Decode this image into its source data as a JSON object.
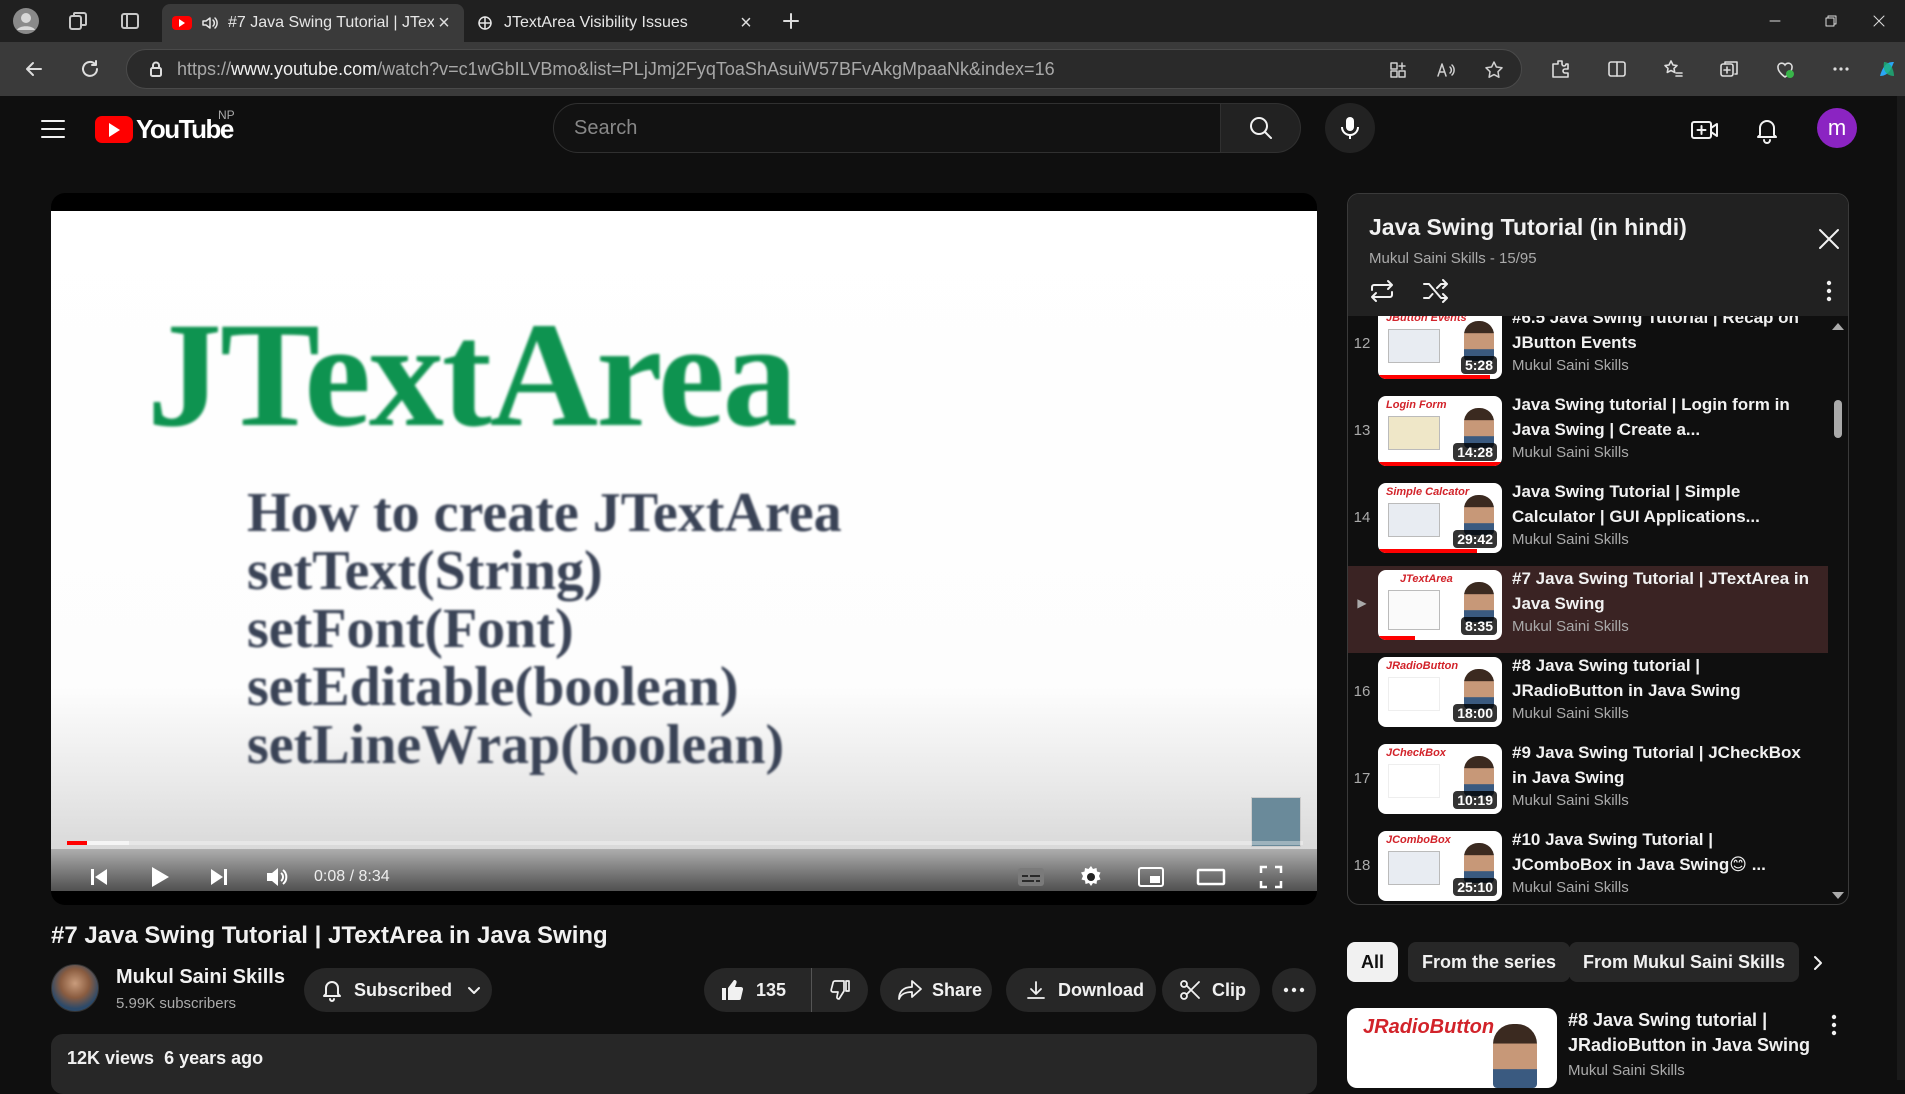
{
  "browser": {
    "tabs": [
      {
        "title": "#7 Java Swing Tutorial | JTextArea in Java Swing",
        "active": true
      },
      {
        "title": "JTextArea Visibility Issues",
        "active": false
      }
    ],
    "url_prefix": "https://",
    "url_host": "www.youtube.com",
    "url_path": "/watch?v=c1wGbILVBmo&list=PLjJmj2FyqToaShAsuiW57BFvAkgMpaaNk&index=16"
  },
  "youtube": {
    "logo_text": "YouTube",
    "country_code": "NP",
    "search_placeholder": "Search",
    "avatar_letter": "m"
  },
  "player": {
    "slide_title": "JTextArea",
    "slide_lines": [
      "How to create JTextArea",
      "setText(String)",
      "setFont(Font)",
      "setEditable(boolean)",
      "setLineWrap(boolean)"
    ],
    "time": "0:08 / 8:34",
    "progress_fraction": 0.016,
    "buffered_fraction": 0.05
  },
  "video": {
    "title": "#7 Java Swing Tutorial | JTextArea in Java Swing",
    "channel": "Mukul Saini Skills",
    "subscribers": "5.99K subscribers",
    "subscribed_label": "Subscribed",
    "likes": "135",
    "share_label": "Share",
    "download_label": "Download",
    "clip_label": "Clip",
    "views": "12K views",
    "age": "6 years ago"
  },
  "playlist": {
    "title": "Java Swing Tutorial (in hindi)",
    "subtitle": "Mukul Saini Skills - 15/95",
    "items": [
      {
        "index": "12",
        "title": "#6.5 Java Swing Tutorial | Recap on JButton Events",
        "channel": "Mukul Saini Skills",
        "duration": "5:28",
        "thumb_label": "JButton Events",
        "watched": 0.9
      },
      {
        "index": "13",
        "title": "Java Swing tutorial | Login form in Java Swing | Create a...",
        "channel": "Mukul Saini Skills",
        "duration": "14:28",
        "thumb_label": "Login Form",
        "watched": 1.0
      },
      {
        "index": "14",
        "title": "Java Swing Tutorial | Simple Calculator | GUI Applications...",
        "channel": "Mukul Saini Skills",
        "duration": "29:42",
        "thumb_label": "Simple Calcator",
        "watched": 0.8
      },
      {
        "index": "▶",
        "title": "#7 Java Swing Tutorial | JTextArea in Java Swing",
        "channel": "Mukul Saini Skills",
        "duration": "8:35",
        "thumb_label": "JTextArea",
        "watched": 0.3,
        "current": true
      },
      {
        "index": "16",
        "title": "#8 Java Swing tutorial | JRadioButton in Java Swing",
        "channel": "Mukul Saini Skills",
        "duration": "18:00",
        "thumb_label": "JRadioButton",
        "watched": 0
      },
      {
        "index": "17",
        "title": "#9 Java Swing Tutorial | JCheckBox in Java Swing",
        "channel": "Mukul Saini Skills",
        "duration": "10:19",
        "thumb_label": "JCheckBox",
        "watched": 0
      },
      {
        "index": "18",
        "title": "#10 Java Swing Tutorial | JComboBox in Java Swing😊 ...",
        "channel": "Mukul Saini Skills",
        "duration": "25:10",
        "thumb_label": "JComboBox",
        "watched": 0
      }
    ]
  },
  "chips": [
    "All",
    "From the series",
    "From Mukul Saini Skills"
  ],
  "recommendation": {
    "thumb_label": "JRadioButton",
    "title": "#8 Java Swing tutorial | JRadioButton in Java Swing",
    "channel": "Mukul Saini Skills"
  },
  "colors": {
    "accent_red": "#ff0000",
    "avatar_purple": "#8b24c2",
    "slide_green": "#0e9350"
  }
}
